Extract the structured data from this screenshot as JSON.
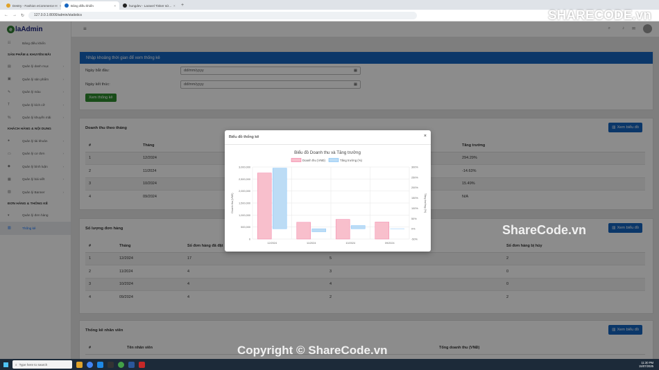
{
  "browser": {
    "tabs": [
      {
        "title": "Destry - Fashion eCommerce H"
      },
      {
        "title": "Bảng điều khiển"
      },
      {
        "title": "hungdev - Laravel Tinker sử..."
      }
    ],
    "new_tab": "+",
    "url": "127.0.0.1:8000/admin/statistics"
  },
  "brand": {
    "logo_mark": "e",
    "logo_text": "laAdmin"
  },
  "sidebar": {
    "dashboard": "Bảng điều khiển",
    "section1": "SẢN PHẨM & KHUYẾN MÃI",
    "s1_items": [
      "Quản lý danh mục",
      "Quản lý sản phẩm",
      "Quản lý màu",
      "Quản lý kích cỡ",
      "Quản lý khuyến mãi"
    ],
    "section2": "KHÁCH HÀNG & NỘI DUNG",
    "s2_items": [
      "Quản lý tài khoản",
      "Quản lý cơ đơn",
      "Quản lý bình luận",
      "Quản lý bài viết",
      "Quản lý Banner"
    ],
    "section3": "ĐƠN HÀNG & THỐNG KÊ",
    "s3_items": [
      "Quản lý đơn hàng",
      "Thống kê"
    ]
  },
  "filter": {
    "heading": "Nhập khoảng thời gian để xem thống kê",
    "start_label": "Ngày bắt đầu:",
    "end_label": "Ngày kết thúc:",
    "date_placeholder": "dd/mm/yyyy",
    "submit": "Xem thống kê"
  },
  "revenue": {
    "title": "Doanh thu theo tháng",
    "button": "Xem biểu đồ",
    "headers": [
      "#",
      "Tháng",
      "",
      "Tăng trưởng"
    ],
    "rows": [
      [
        "1",
        "12/2024",
        "",
        "294.29%"
      ],
      [
        "2",
        "11/2024",
        "",
        "-14.63%"
      ],
      [
        "3",
        "10/2024",
        "",
        "15.49%"
      ],
      [
        "4",
        "09/2024",
        "",
        "N/A"
      ]
    ]
  },
  "orders": {
    "title": "Số lượng đơn hàng",
    "button": "Xem biểu đồ",
    "headers": [
      "#",
      "Tháng",
      "Số đơn hàng đã đặt",
      "",
      "Số đơn hàng bị hủy"
    ],
    "rows": [
      [
        "1",
        "12/2024",
        "17",
        "5",
        "2"
      ],
      [
        "2",
        "11/2024",
        "4",
        "3",
        "0"
      ],
      [
        "3",
        "10/2024",
        "4",
        "4",
        "0"
      ],
      [
        "4",
        "09/2024",
        "4",
        "2",
        "2"
      ]
    ]
  },
  "staff": {
    "title": "Thống kê nhân viên",
    "button": "Xem biểu đồ",
    "headers": [
      "#",
      "Tên nhân viên",
      "",
      "Tổng doanh thu (VNĐ)"
    ]
  },
  "modal": {
    "title": "Biểu đồ thống kê",
    "close": "×"
  },
  "chart_data": {
    "type": "bar",
    "title": "Biểu đồ Doanh thu và Tăng trưởng",
    "categories": [
      "12/2024",
      "11/2024",
      "10/2024",
      "09/2024"
    ],
    "series": [
      {
        "name": "Doanh thu (VNĐ)",
        "axis": "left",
        "color": "#f8bfcc",
        "values": [
          2750000,
          698000,
          818000,
          708000
        ]
      },
      {
        "name": "Tăng trưởng (%)",
        "axis": "right",
        "color": "#bcdcf5",
        "values": [
          294.29,
          -14.63,
          15.49,
          0
        ]
      }
    ],
    "ylabel": "Doanh thu (VNĐ)",
    "y2label": "Tăng trưởng (%)",
    "ylim": [
      0,
      3000000
    ],
    "y2lim": [
      -50,
      300
    ],
    "yticks": [
      "0",
      "500,000",
      "1,000,000",
      "1,500,000",
      "2,000,000",
      "2,500,000",
      "3,000,000"
    ],
    "y2ticks": [
      "-50%",
      "0%",
      "50%",
      "100%",
      "150%",
      "200%",
      "250%",
      "300%"
    ],
    "legend": "top",
    "grid": true
  },
  "taskbar": {
    "search": "Type here to search",
    "time": "11:30 PM",
    "date": "15/07/2025"
  },
  "watermarks": {
    "logo": "SHARECODE.vn",
    "mid": "ShareCode.vn",
    "bottom": "Copyright © ShareCode.vn"
  }
}
